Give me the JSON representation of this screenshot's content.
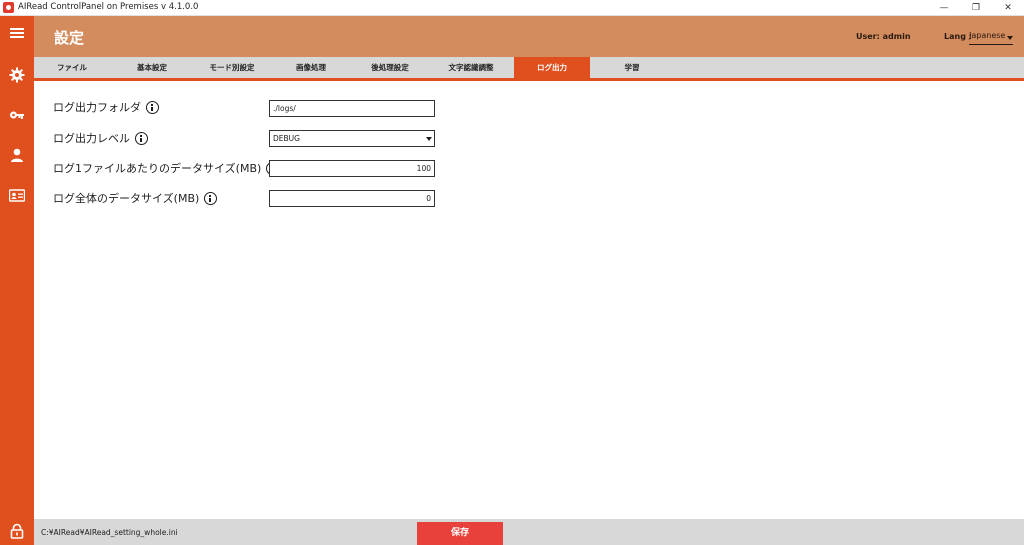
{
  "window": {
    "title": "AIRead ControlPanel on Premises v 4.1.0.0",
    "minimize_glyph": "—",
    "maximize_glyph": "❐",
    "close_glyph": "✕"
  },
  "sidebar": {
    "items": [
      {
        "icon": "menu-icon"
      },
      {
        "icon": "gear-icon"
      },
      {
        "icon": "key-icon"
      },
      {
        "icon": "user-icon"
      },
      {
        "icon": "id-card-icon"
      },
      {
        "icon": "lock-icon"
      }
    ]
  },
  "header": {
    "title": "設定",
    "user": "User: admin",
    "lang_label": "Lang :",
    "lang_value": "Japanese"
  },
  "tabs": [
    {
      "label": "ファイル",
      "active": false
    },
    {
      "label": "基本設定",
      "active": false
    },
    {
      "label": "モード別設定",
      "active": false
    },
    {
      "label": "画像処理",
      "active": false
    },
    {
      "label": "後処理設定",
      "active": false
    },
    {
      "label": "文字認識調整",
      "active": false
    },
    {
      "label": "ログ出力",
      "active": true
    },
    {
      "label": "学習",
      "active": false
    }
  ],
  "form": {
    "fields": [
      {
        "label": "ログ出力フォルダ",
        "value": "./logs/"
      },
      {
        "label": "ログ出力レベル",
        "value": "DEBUG"
      },
      {
        "label": "ログ1ファイルあたりのデータサイズ(MB)",
        "value": "100"
      },
      {
        "label": "ログ全体のデータサイズ(MB)",
        "value": "0"
      }
    ]
  },
  "footer": {
    "path": "C:¥AIRead¥AIRead_setting_whole.ini",
    "save_label": "保存"
  },
  "colors": {
    "accent": "#e0501f",
    "header": "#d38c5e",
    "save": "#e8403a"
  }
}
